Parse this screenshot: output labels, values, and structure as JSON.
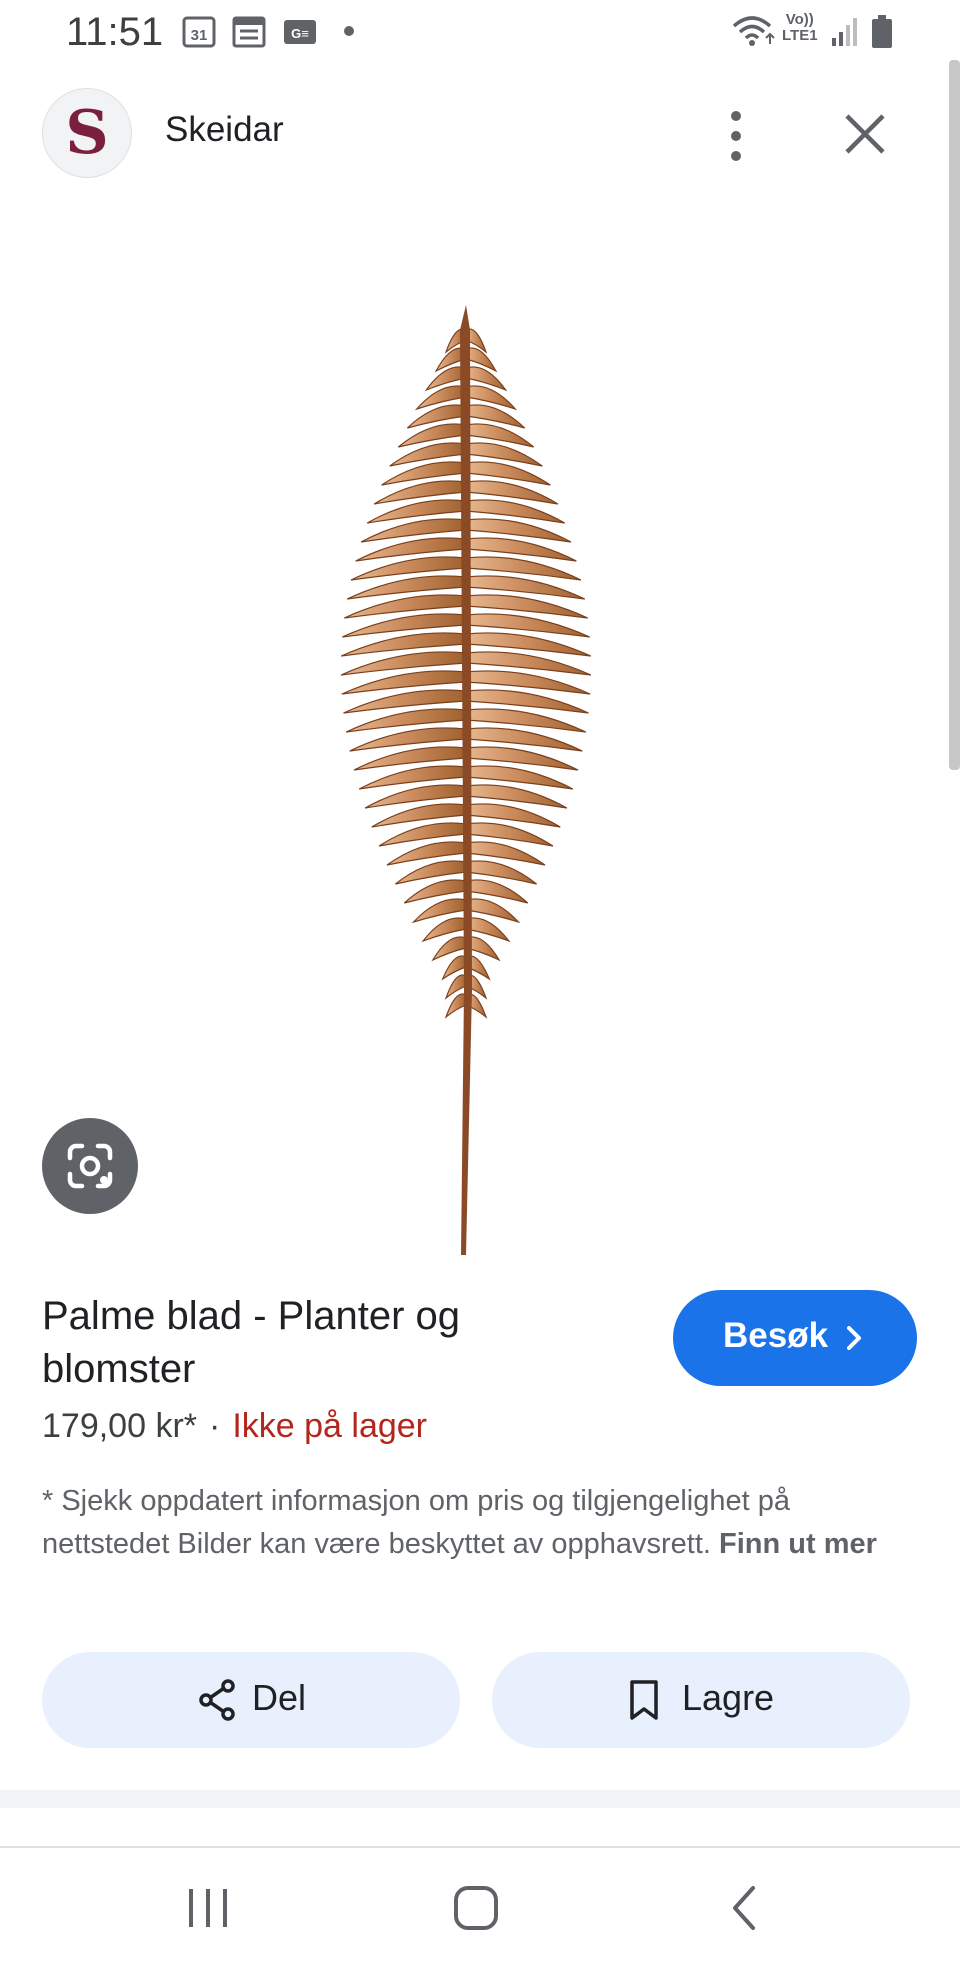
{
  "status_bar": {
    "time": "11:51",
    "calendar_day": "31",
    "network_top": "Vo))",
    "network_bottom": "LTE1",
    "icons": [
      "calendar-icon",
      "calendar-grid-icon",
      "gallery-icon",
      "notification-dot-icon",
      "wifi-icon",
      "signal-icon",
      "battery-icon"
    ]
  },
  "header": {
    "site_logo_letter": "S",
    "site_name": "Skeidar",
    "logo_color": "#7a1f3d",
    "icons": [
      "more-vert-icon",
      "close-icon"
    ]
  },
  "product": {
    "image_icon": "fern-leaf-image",
    "lens_icon": "lens-search-icon",
    "title": "Palme blad - Planter og blomster",
    "price": "179,00 kr*",
    "separator": "·",
    "stock_status": "Ikke på lager",
    "stock_color": "#b3261e",
    "visit_label": "Besøk",
    "visit_color": "#1a73e8",
    "disclaimer": "* Sjekk oppdatert informasjon om pris og tilgjengelighet på nettstedet Bilder kan være beskyttet av opphavsrett.",
    "learn_more": "Finn ut mer"
  },
  "actions": {
    "share_label": "Del",
    "save_label": "Lagre",
    "icons": [
      "share-icon",
      "bookmark-icon"
    ]
  },
  "nav_bar": {
    "icons": [
      "recent-apps-icon",
      "home-icon",
      "back-icon"
    ]
  }
}
